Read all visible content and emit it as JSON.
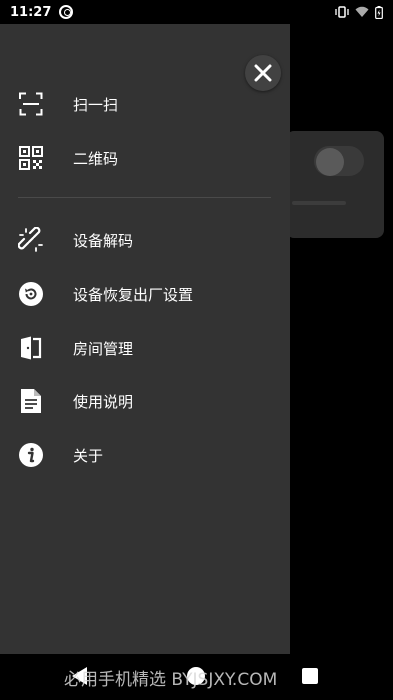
{
  "status_bar": {
    "time": "11:27"
  },
  "drawer": {
    "items": [
      {
        "label": "扫一扫",
        "icon": "scan-icon"
      },
      {
        "label": "二维码",
        "icon": "qr-code-icon"
      },
      {
        "label": "设备解码",
        "icon": "unlink-icon"
      },
      {
        "label": "设备恢复出厂设置",
        "icon": "factory-reset-icon"
      },
      {
        "label": "房间管理",
        "icon": "door-icon"
      },
      {
        "label": "使用说明",
        "icon": "document-icon"
      },
      {
        "label": "关于",
        "icon": "info-icon"
      }
    ]
  },
  "watermark": "必用手机精选 BYJSJXY.COM",
  "colors": {
    "drawer_bg": "#333333",
    "screen_bg": "#000000",
    "close_button_bg": "#424242"
  }
}
